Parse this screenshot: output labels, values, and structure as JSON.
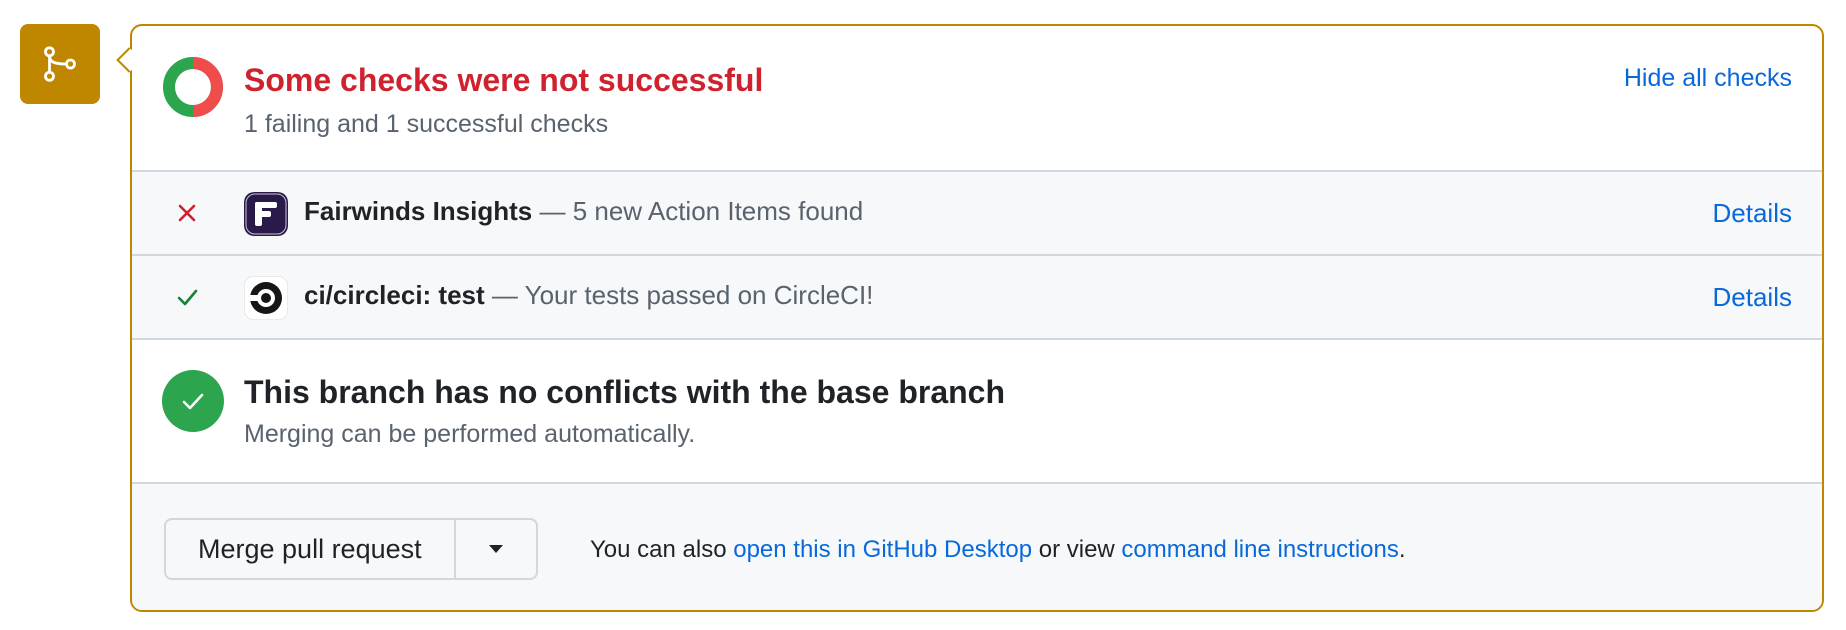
{
  "status": {
    "title": "Some checks were not successful",
    "subtitle": "1 failing and 1 successful checks",
    "toggle_label": "Hide all checks",
    "failing": 1,
    "successful": 1,
    "colors": {
      "fail": "#f04c4c",
      "success": "#2da44e"
    }
  },
  "checks": [
    {
      "name": "Fairwinds Insights",
      "description": " — 5 new Action Items found",
      "state": "failure",
      "icon": "close-icon",
      "app_icon": "fairwinds-logo-icon",
      "link": "Details"
    },
    {
      "name": "ci/circleci: test",
      "description": " — Your tests passed on CircleCI!",
      "state": "success",
      "icon": "check-icon",
      "app_icon": "circleci-logo-icon",
      "link": "Details"
    }
  ],
  "merge_status": {
    "title": "This branch has no conflicts with the base branch",
    "subtitle": "Merging can be performed automatically."
  },
  "actions": {
    "merge_button": "Merge pull request",
    "text_prefix": "You can also ",
    "desktop_link": "open this in GitHub Desktop",
    "text_middle": " or view ",
    "cli_link": "command line instructions",
    "text_suffix": "."
  }
}
